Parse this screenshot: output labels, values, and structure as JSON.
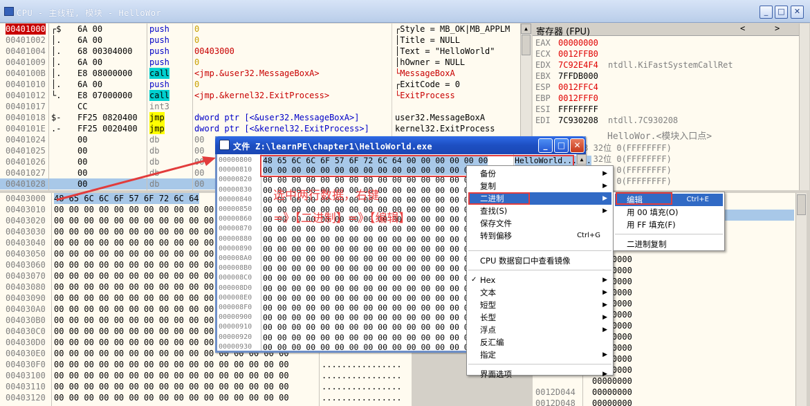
{
  "main_window": {
    "title": "CPU - 主线程, 模块 - HelloWor"
  },
  "popup_window": {
    "title": "文件 Z:\\learnPE\\chapter1\\HelloWorld.exe"
  },
  "registers_header": {
    "title": "寄存器 (FPU)",
    "nav_left": "<",
    "nav_right": ">"
  },
  "disasm": [
    {
      "addr": "00401000",
      "mark": "┌$",
      "bytes": "6A 00",
      "op": "push",
      "opclass": "blue",
      "arg": "0",
      "argclass": "olive",
      "sel_addr": true
    },
    {
      "addr": "00401002",
      "mark": "│.",
      "bytes": "6A 00",
      "op": "push",
      "opclass": "blue",
      "arg": "0",
      "argclass": "olive"
    },
    {
      "addr": "00401004",
      "mark": "│.",
      "bytes": "68 00304000",
      "op": "push",
      "opclass": "blue",
      "arg": "00403000",
      "argclass": "red"
    },
    {
      "addr": "00401009",
      "mark": "│.",
      "bytes": "6A 00",
      "op": "push",
      "opclass": "blue",
      "arg": "0",
      "argclass": "olive"
    },
    {
      "addr": "0040100B",
      "mark": "│.",
      "bytes": "E8 08000000",
      "op": "call",
      "opclass": "cyan",
      "arg": "<jmp.&user32.MessageBoxA>",
      "argclass": "red"
    },
    {
      "addr": "00401010",
      "mark": "│.",
      "bytes": "6A 00",
      "op": "push",
      "opclass": "blue",
      "arg": "0",
      "argclass": "olive"
    },
    {
      "addr": "00401012",
      "mark": "└.",
      "bytes": "E8 07000000",
      "op": "call",
      "opclass": "cyan",
      "arg": "<jmp.&kernel32.ExitProcess>",
      "argclass": "red"
    },
    {
      "addr": "00401017",
      "mark": "",
      "bytes": "CC",
      "op": "int3",
      "opclass": "gray",
      "arg": "",
      "argclass": ""
    },
    {
      "addr": "00401018",
      "mark": "$-",
      "bytes": "FF25 0820400",
      "op": "jmp",
      "opclass": "yellow",
      "arg": "dword ptr [<&user32.MessageBoxA>]",
      "argclass": "blue"
    },
    {
      "addr": "0040101E",
      "mark": ".-",
      "bytes": "FF25 0020400",
      "op": "jmp",
      "opclass": "yellow",
      "arg": "dword ptr [<&kernel32.ExitProcess>]",
      "argclass": "blue"
    },
    {
      "addr": "00401024",
      "mark": "",
      "bytes": "00",
      "op": "db",
      "opclass": "gray",
      "arg": "00",
      "argclass": "gray"
    },
    {
      "addr": "00401025",
      "mark": "",
      "bytes": "00",
      "op": "db",
      "opclass": "gray",
      "arg": "00",
      "argclass": "gray"
    },
    {
      "addr": "00401026",
      "mark": "",
      "bytes": "00",
      "op": "db",
      "opclass": "gray",
      "arg": "00",
      "argclass": "gray"
    },
    {
      "addr": "00401027",
      "mark": "",
      "bytes": "00",
      "op": "db",
      "opclass": "gray",
      "arg": "00",
      "argclass": "gray"
    },
    {
      "addr": "00401028",
      "mark": "",
      "bytes": "00",
      "op": "db",
      "opclass": "gray",
      "arg": "00",
      "argclass": "gray",
      "selected": true
    }
  ],
  "comments": [
    {
      "text": "┌Style = MB_OK|MB_APPLM",
      "cls": ""
    },
    {
      "text": "│Title = NULL",
      "cls": ""
    },
    {
      "text": "│Text = \"HelloWorld\"",
      "cls": ""
    },
    {
      "text": "│hOwner = NULL",
      "cls": ""
    },
    {
      "text": "└MessageBoxA",
      "cls": "red"
    },
    {
      "text": "┌ExitCode = 0",
      "cls": ""
    },
    {
      "text": "└ExitProcess",
      "cls": "red"
    },
    {
      "text": "",
      "cls": ""
    },
    {
      "text": "user32.MessageBoxA",
      "cls": ""
    },
    {
      "text": "kernel32.ExitProcess",
      "cls": ""
    }
  ],
  "registers": [
    {
      "name": "EAX",
      "value": "00000000",
      "red": true,
      "note": ""
    },
    {
      "name": "ECX",
      "value": "0012FFB0",
      "red": true,
      "note": ""
    },
    {
      "name": "EDX",
      "value": "7C92E4F4",
      "red": true,
      "note": "ntdll.KiFastSystemCallRet"
    },
    {
      "name": "EBX",
      "value": "7FFDB000",
      "red": false,
      "note": ""
    },
    {
      "name": "ESP",
      "value": "0012FFC4",
      "red": true,
      "note": ""
    },
    {
      "name": "EBP",
      "value": "0012FFF0",
      "red": true,
      "note": ""
    },
    {
      "name": "ESI",
      "value": "FFFFFFFF",
      "red": false,
      "note": ""
    },
    {
      "name": "EDI",
      "value": "7C930208",
      "red": false,
      "note": "ntdll.7C930208"
    }
  ],
  "reg_partial": [
    {
      "text": "HelloWor.<模块入口点>"
    },
    {
      "text": "23 32位 0(FFFFFFFF)"
    },
    {
      "text": "1B 32位 0(FFFFFFFF)"
    },
    {
      "text": "23 32位 0(FFFFFFFF)"
    },
    {
      "text": "23 32位 0(FFFFFFFF)"
    }
  ],
  "dump_rows": [
    {
      "addr": "00403000",
      "hex": "48 65 6C 6C 6F 57 6F 72 6C 64",
      "sel": true
    },
    {
      "addr": "00403010",
      "hex": "00 00 00 00 00 00 00 00 00 00 00 00 00 00 00 00"
    },
    {
      "addr": "00403020",
      "hex": "00 00 00 00 00 00 00 00 00 00 00 00 00 00 00 00"
    },
    {
      "addr": "00403030",
      "hex": "00 00 00 00 00 00 00 00 00 00 00 00 00 00 00 00"
    },
    {
      "addr": "00403040",
      "hex": "00 00 00 00 00 00 00 00 00 00 00 00 00 00 00 00"
    },
    {
      "addr": "00403050",
      "hex": "00 00 00 00 00 00 00 00 00 00 00 00 00 00 00 00"
    },
    {
      "addr": "00403060",
      "hex": "00 00 00 00 00 00 00 00 00 00 00 00 00 00 00 00"
    },
    {
      "addr": "00403070",
      "hex": "00 00 00 00 00 00 00 00 00 00 00 00 00 00 00 00"
    },
    {
      "addr": "00403080",
      "hex": "00 00 00 00 00 00 00 00 00 00 00 00 00 00 00 00"
    },
    {
      "addr": "00403090",
      "hex": "00 00 00 00 00 00 00 00 00 00 00 00 00 00 00 00"
    },
    {
      "addr": "004030A0",
      "hex": "00 00 00 00 00 00 00 00 00 00 00 00 00 00 00 00"
    },
    {
      "addr": "004030B0",
      "hex": "00 00 00 00 00 00 00 00 00 00 00 00 00 00 00 00"
    },
    {
      "addr": "004030C0",
      "hex": "00 00 00 00 00 00 00 00 00 00 00 00 00 00 00 00"
    },
    {
      "addr": "004030D0",
      "hex": "00 00 00 00 00 00 00 00 00 00 00 00 00 00 00 00"
    },
    {
      "addr": "004030E0",
      "hex": "00 00 00 00 00 00 00 00 00 00 00 00 00 00 00 00"
    },
    {
      "addr": "004030F0",
      "hex": "00 00 00 00 00 00 00 00 00 00 00 00 00 00 00 00",
      "asc": "................"
    },
    {
      "addr": "00403100",
      "hex": "00 00 00 00 00 00 00 00 00 00 00 00 00 00 00 00",
      "asc": "................"
    },
    {
      "addr": "00403110",
      "hex": "00 00 00 00 00 00 00 00 00 00 00 00 00 00 00 00",
      "asc": "................"
    },
    {
      "addr": "00403120",
      "hex": "00 00 00 00 00 00 00 00 00 00 00 00 00 00 00 00",
      "asc": "................"
    }
  ],
  "stack_rows": [
    {
      "addr": "",
      "val": "00000000"
    },
    {
      "addr": "",
      "val": "00000000"
    },
    {
      "addr": "",
      "val": "00000000"
    },
    {
      "addr": "",
      "val": "00000000"
    },
    {
      "addr": "",
      "val": "00000000"
    },
    {
      "addr": "",
      "val": "00000000"
    },
    {
      "addr": "",
      "val": "00000000"
    },
    {
      "addr": "",
      "val": "00000000"
    },
    {
      "addr": "",
      "val": "00000000"
    },
    {
      "addr": "",
      "val": "00000000"
    },
    {
      "addr": "",
      "val": "00000000"
    },
    {
      "addr": "",
      "val": "00000000"
    },
    {
      "addr": "",
      "val": "00000000"
    },
    {
      "addr": "",
      "val": "00000000"
    },
    {
      "addr": "0012D044",
      "val": "00000000"
    },
    {
      "addr": "0012D048",
      "val": "00000000"
    }
  ],
  "file_rows": [
    {
      "addr": "00000800",
      "hex": "48 65 6C 6C 6F 57 6F 72 6C 64 00 00 00 00 00 00",
      "asc": "HelloWorld......",
      "sel": true
    },
    {
      "addr": "00000810",
      "hex": "00 00 00 00 00 00 00 00 00 00 00 00 00 00 00 00",
      "asc": "................",
      "sel": true
    },
    {
      "addr": "00000820",
      "hex": "00 00 00 00 00 00 00 00 00 00 00 00 00 00 00 00",
      "asc": ""
    },
    {
      "addr": "00000830",
      "hex": "00 00 00 00 00 00 00 00 00 00 00 00 00 00 00 00",
      "asc": ""
    },
    {
      "addr": "00000840",
      "hex": "00 00 00 00 00 00 00 00 00 00 00 00 00 00 00 00",
      "asc": ""
    },
    {
      "addr": "00000850",
      "hex": "00 00 00 00 00 00 00 00 00 00 00 00 00 00 00 00",
      "asc": ""
    },
    {
      "addr": "00000860",
      "hex": "00 00 00 00 00 00 00 00 00 00 00 00 00 00 00 00",
      "asc": ""
    },
    {
      "addr": "00000870",
      "hex": "00 00 00 00 00 00 00 00 00 00 00 00 00 00 00 00",
      "asc": ""
    },
    {
      "addr": "00000880",
      "hex": "00 00 00 00 00 00 00 00 00 00 00 00 00 00 00 00",
      "asc": ""
    },
    {
      "addr": "00000890",
      "hex": "00 00 00 00 00 00 00 00 00 00 00 00 00 00 00 00",
      "asc": ""
    },
    {
      "addr": "000008A0",
      "hex": "00 00 00 00 00 00 00 00 00 00 00 00 00 00 00 00",
      "asc": ""
    },
    {
      "addr": "000008B0",
      "hex": "00 00 00 00 00 00 00 00 00 00 00 00 00 00 00 00",
      "asc": ""
    },
    {
      "addr": "000008C0",
      "hex": "00 00 00 00 00 00 00 00 00 00 00 00 00 00 00 00",
      "asc": ""
    },
    {
      "addr": "000008D0",
      "hex": "00 00 00 00 00 00 00 00 00 00 00 00 00 00 00 00",
      "asc": ""
    },
    {
      "addr": "000008E0",
      "hex": "00 00 00 00 00 00 00 00 00 00 00 00 00 00 00 00",
      "asc": ""
    },
    {
      "addr": "000008F0",
      "hex": "00 00 00 00 00 00 00 00 00 00 00 00 00 00 00 00",
      "asc": ""
    },
    {
      "addr": "00000900",
      "hex": "00 00 00 00 00 00 00 00 00 00 00 00 00 00 00 00",
      "asc": ""
    },
    {
      "addr": "00000910",
      "hex": "00 00 00 00 00 00 00 00 00 00 00 00 00 00 00 00",
      "asc": ""
    },
    {
      "addr": "00000920",
      "hex": "00 00 00 00 00 00 00 00 00 00 00 00 00 00 00 00",
      "asc": ""
    },
    {
      "addr": "00000930",
      "hex": "00 00 00 00 00 00 00 00 00 00 00 00 00 00 00 00",
      "asc": ""
    }
  ],
  "context_menu": [
    {
      "label": "备份",
      "arrow": true
    },
    {
      "label": "复制",
      "arrow": true
    },
    {
      "label": "二进制",
      "arrow": true,
      "hl": true
    },
    {
      "label": "查找(S)",
      "arrow": true
    },
    {
      "label": "保存文件",
      "arrow": false
    },
    {
      "label": "转到偏移",
      "arrow": false,
      "shortcut": "Ctrl+G"
    },
    {
      "sep": true
    },
    {
      "label": "CPU 数据窗口中查看镜像",
      "arrow": false
    },
    {
      "sep": true
    },
    {
      "label": "Hex",
      "arrow": true,
      "check": true
    },
    {
      "label": "文本",
      "arrow": true
    },
    {
      "label": "短型",
      "arrow": true
    },
    {
      "label": "长型",
      "arrow": true
    },
    {
      "label": "浮点",
      "arrow": true
    },
    {
      "label": "反汇编",
      "arrow": false
    },
    {
      "label": "指定",
      "arrow": true
    },
    {
      "sep": true
    },
    {
      "label": "界面选项",
      "arrow": true
    }
  ],
  "submenu": [
    {
      "label": "编辑",
      "shortcut": "Ctrl+E",
      "hl": true
    },
    {
      "label": "用 00 填充(O)"
    },
    {
      "label": "用 FF 填充(F)"
    },
    {
      "sep": true
    },
    {
      "label": "二进制复制"
    }
  ],
  "annotation": {
    "line1": "选中两行数据，右键",
    "line2": "=》【二进制】=》【编辑】"
  },
  "colors": {
    "accent_red": "#e23c3c",
    "selection": "#a8c8e8",
    "menu_highlight": "#316ac5"
  }
}
